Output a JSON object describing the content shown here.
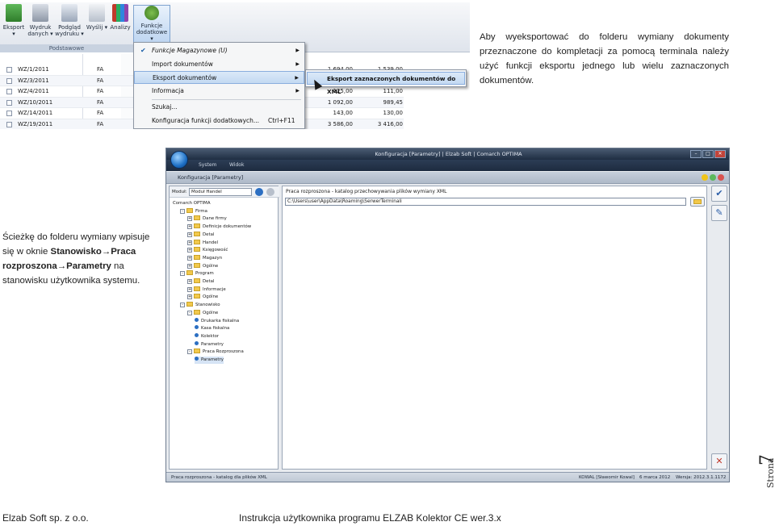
{
  "shot1": {
    "ribbon": {
      "buttons": [
        {
          "label": "Eksport",
          "icon": "export-icon"
        },
        {
          "label": "Wydruk danych",
          "icon": "print-icon"
        },
        {
          "label": "Podgląd wydruku",
          "icon": "print-preview-icon"
        },
        {
          "label": "Wyślij",
          "icon": "send-icon"
        },
        {
          "label": "Analizy",
          "icon": "analysis-icon"
        },
        {
          "label": "Funkcje dodatkowe",
          "icon": "functions-icon"
        }
      ],
      "group_label": "Podstawowe"
    },
    "rows": [
      {
        "doc": "WZ/1/2011",
        "type": "FA",
        "v1": "1 694,00",
        "v2": "1 539,00"
      },
      {
        "doc": "WZ/3/2011",
        "type": "FA",
        "v1": "",
        "v2": ""
      },
      {
        "doc": "WZ/4/2011",
        "type": "FA",
        "v1": "125,00",
        "v2": "111,00"
      },
      {
        "doc": "WZ/10/2011",
        "type": "FA",
        "v1": "1 092,00",
        "v2": "989,45"
      },
      {
        "doc": "WZ/14/2011",
        "type": "FA",
        "v1": "143,00",
        "v2": "130,00"
      },
      {
        "doc": "WZ/19/2011",
        "type": "FA",
        "v1": "3 586,00",
        "v2": "3 416,00"
      }
    ],
    "menu": {
      "items": [
        {
          "label": "Funkcje Magazynowe (U)",
          "arrow": "▶"
        },
        {
          "label": "Import dokumentów",
          "arrow": "▶"
        },
        {
          "label": "Eksport dokumentów",
          "arrow": "▶"
        },
        {
          "label": "Informacja",
          "arrow": "▶"
        },
        {
          "label": "Szukaj..."
        },
        {
          "label": "Konfiguracja funkcji dodatkowych...",
          "shortcut": "Ctrl+F11"
        }
      ],
      "submenu_label": "Eksport zaznaczonych dokumentów do XML"
    }
  },
  "text": {
    "para1": "Aby wyeksportować do folderu wymiany dokumenty przeznaczone do kompletacji za pomocą terminala należy użyć funkcji eksportu jednego lub wielu zaznaczonych dokumentów.",
    "para2_a": "Ścieżkę do folderu wymiany wpisuje się w oknie ",
    "para2_b": "Stanowisko",
    "para2_arrow1": "→",
    "para2_c": "Praca rozproszona",
    "para2_arrow2": "→",
    "para2_d": "Parametry",
    "para2_e": " na stanowisku użytkownika systemu."
  },
  "shot2": {
    "title": "Konfiguracja [Parametry] | Elzab Soft | Comarch OPTIMA",
    "menubar": [
      "System",
      "Widok"
    ],
    "doc_title": "Konfiguracja [Parametry]",
    "module_label": "Moduł:",
    "module_value": "Moduł Handel",
    "tree": [
      {
        "label": "Comarch OPTIMA",
        "level": 0,
        "kind": "root"
      },
      {
        "label": "Firma",
        "level": 1,
        "kind": "folder",
        "pm": "-"
      },
      {
        "label": "Dane firmy",
        "level": 2,
        "kind": "folder",
        "pm": "+"
      },
      {
        "label": "Definicje dokumentów",
        "level": 2,
        "kind": "folder",
        "pm": "+"
      },
      {
        "label": "Detal",
        "level": 2,
        "kind": "folder",
        "pm": "+"
      },
      {
        "label": "Handel",
        "level": 2,
        "kind": "folder",
        "pm": "+"
      },
      {
        "label": "Księgowość",
        "level": 2,
        "kind": "folder",
        "pm": "+"
      },
      {
        "label": "Magazyn",
        "level": 2,
        "kind": "folder",
        "pm": "+"
      },
      {
        "label": "Ogólne",
        "level": 2,
        "kind": "folder",
        "pm": "+"
      },
      {
        "label": "Program",
        "level": 1,
        "kind": "folder",
        "pm": "-"
      },
      {
        "label": "Detal",
        "level": 2,
        "kind": "folder",
        "pm": "+"
      },
      {
        "label": "Informacje",
        "level": 2,
        "kind": "folder",
        "pm": "+"
      },
      {
        "label": "Ogólne",
        "level": 2,
        "kind": "folder",
        "pm": "+"
      },
      {
        "label": "Stanowisko",
        "level": 1,
        "kind": "folder",
        "pm": "-"
      },
      {
        "label": "Ogólne",
        "level": 2,
        "kind": "folder",
        "pm": "-"
      },
      {
        "label": "Drukarka fiskalna",
        "level": 3,
        "kind": "item"
      },
      {
        "label": "Kasa fiskalna",
        "level": 3,
        "kind": "item"
      },
      {
        "label": "Kolektor",
        "level": 3,
        "kind": "item"
      },
      {
        "label": "Parametry",
        "level": 3,
        "kind": "item"
      },
      {
        "label": "Praca Rozproszona",
        "level": 2,
        "kind": "folder",
        "pm": "-"
      },
      {
        "label": "Parametry",
        "level": 3,
        "kind": "item",
        "selected": true
      }
    ],
    "panel_title": "Praca rozproszona - katalog przechowywania plików wymiany XML",
    "path_value": "C:\\Users\\user\\AppData\\Roaming\\SerwerTerminali",
    "status_left": "Praca rozproszona - katalog dla plików XML",
    "status_user": "KOWAL [Sławomir Kowal]",
    "status_date": "6 marca 2012",
    "status_version": "Wersja: 2012.3.1.1172"
  },
  "page": {
    "word": "Strona",
    "number": "7"
  },
  "footer": {
    "left": "Elzab Soft sp. z o.o.",
    "right": "Instrukcja użytkownika programu ELZAB Kolektor CE wer.3.x"
  },
  "colors": {
    "accent": "#1d6fc4",
    "highlight": "#c3d9f2",
    "close": "#c0392b"
  }
}
